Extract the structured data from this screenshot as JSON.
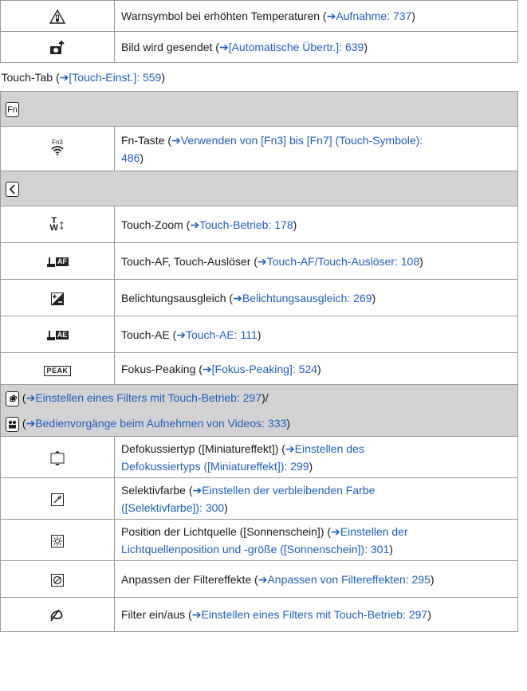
{
  "rows_top": [
    {
      "icon": "temperature-warning-icon",
      "text": "Warnsymbol bei erhöhten Temperaturen (",
      "link": "Aufnahme: 737",
      "tail": ")"
    },
    {
      "icon": "image-sending-icon",
      "text": "Bild wird gesendet (",
      "link": "[Automatische Übertr.]: 639",
      "tail": ")"
    }
  ],
  "touch_tab": {
    "text": "Touch-Tab (",
    "link": "[Touch-Einst.]: 559",
    "tail": ")"
  },
  "fn_header": {
    "icon_text": "Fn"
  },
  "fn_row": {
    "icon_text": "Fn3",
    "text": "Fn-Taste (",
    "link": "Verwenden von [Fn3] bis [Fn7] (Touch-Symbole):",
    "link2": "486",
    "tail": ")"
  },
  "back_header": {
    "icon": "back-arrow-icon"
  },
  "rows_mid": [
    {
      "text": "Touch-Zoom (",
      "link": "Touch-Betrieb: 178",
      "tail": ")",
      "icon_text": "T W"
    },
    {
      "text": "Touch-AF, Touch-Auslöser (",
      "link": "Touch-AF/Touch-Auslöser: 108",
      "tail": ")",
      "badge": "AF"
    },
    {
      "text": "Belichtungsausgleich (",
      "link": "Belichtungsausgleich: 269",
      "tail": ")"
    },
    {
      "text": "Touch-AE (",
      "link": "Touch-AE: 111",
      "tail": ")",
      "badge": "AE"
    },
    {
      "text": "Fokus-Peaking (",
      "link": "[Fokus-Peaking]: 524",
      "tail": ")",
      "badge": "PEAK"
    }
  ],
  "filter_header": {
    "pre": "(",
    "link": "Einstellen eines Filters mit Touch-Betrieb: 297",
    "tail": ")/"
  },
  "video_header": {
    "pre": "(",
    "link": "Bedienvorgänge beim Aufnehmen von Videos: 333",
    "tail": ")"
  },
  "rows_bottom": [
    {
      "line1": "Defokussiertyp ([Miniatureffekt]) (",
      "link1": "Einstellen des",
      "link2": "Defokussiertyps ([Miniatureffekt]): 299",
      "tail": ")"
    },
    {
      "line1": "Selektivfarbe (",
      "link1": "Einstellen der verbleibenden Farbe",
      "link2": "([Selektivfarbe]): 300",
      "tail": ")"
    },
    {
      "line1": "Position der Lichtquelle ([Sonnenschein]) (",
      "link1": "Einstellen der",
      "link2": "Lichtquellenposition und -größe ([Sonnenschein]): 301",
      "tail": ")"
    },
    {
      "line1": "Anpassen der Filtereffekte (",
      "link1": "Anpassen von Filtereffekten: 295",
      "link2": "",
      "tail": ")"
    },
    {
      "line1": "Filter ein/aus (",
      "link1": "Einstellen eines Filters mit Touch-Betrieb: 297",
      "link2": "",
      "tail": ")"
    }
  ],
  "arrow": "➔"
}
